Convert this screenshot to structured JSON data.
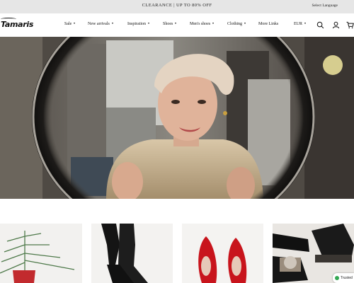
{
  "topbar": {
    "promo": "CLEARANCE | UP TO 80% OFF",
    "language": "Select Language"
  },
  "header": {
    "logo_text": "Tamaris",
    "nav": [
      {
        "label": "Sale",
        "has_dropdown": true
      },
      {
        "label": "New arrivals",
        "has_dropdown": true
      },
      {
        "label": "Inspiration",
        "has_dropdown": true
      },
      {
        "label": "Shoes",
        "has_dropdown": true
      },
      {
        "label": "Men's shoes",
        "has_dropdown": true
      },
      {
        "label": "Clothing",
        "has_dropdown": true
      },
      {
        "label": "More Links",
        "has_dropdown": false
      }
    ],
    "currency": "EUR",
    "icons": [
      "search-icon",
      "account-icon",
      "cart-icon"
    ]
  },
  "hero": {
    "image": "woman with head wrap and sequin top seen through round mirror"
  },
  "products": [
    {
      "image": "red boot with christmas tree branch"
    },
    {
      "image": "black knee-high boots"
    },
    {
      "image": "red pointed flats"
    },
    {
      "image": "black lace-up boots with fur lining"
    }
  ],
  "trust_badge": {
    "label": "Trusted"
  }
}
